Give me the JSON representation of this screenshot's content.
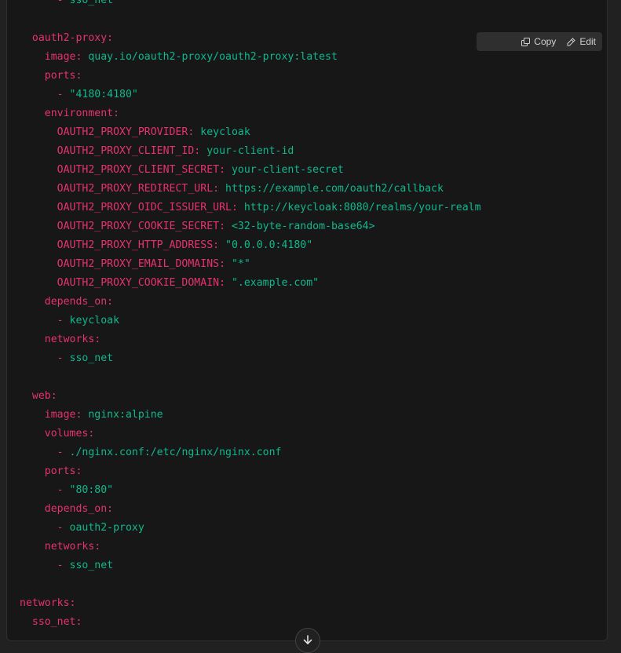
{
  "toolbar": {
    "copy_label": "Copy",
    "edit_label": "Edit",
    "copy_icon": "copy-icon",
    "edit_icon": "pencil-icon"
  },
  "scroll_button": {
    "icon": "arrow-down-icon"
  },
  "colors": {
    "key": "#e6336e",
    "value": "#0fb88d",
    "background": "#171717"
  },
  "code": {
    "language": "yaml",
    "lines": [
      {
        "indent": "      ",
        "dash": "- ",
        "key": "",
        "value": "sso_net"
      },
      {
        "indent": "",
        "dash": "",
        "key": "",
        "value": ""
      },
      {
        "indent": "  ",
        "dash": "",
        "key": "oauth2-proxy:",
        "value": ""
      },
      {
        "indent": "    ",
        "dash": "",
        "key": "image:",
        "value": " quay.io/oauth2-proxy/oauth2-proxy:latest"
      },
      {
        "indent": "    ",
        "dash": "",
        "key": "ports:",
        "value": ""
      },
      {
        "indent": "      ",
        "dash": "- ",
        "key": "",
        "value": "\"4180:4180\""
      },
      {
        "indent": "    ",
        "dash": "",
        "key": "environment:",
        "value": ""
      },
      {
        "indent": "      ",
        "dash": "",
        "key": "OAUTH2_PROXY_PROVIDER:",
        "value": " keycloak"
      },
      {
        "indent": "      ",
        "dash": "",
        "key": "OAUTH2_PROXY_CLIENT_ID:",
        "value": " your-client-id"
      },
      {
        "indent": "      ",
        "dash": "",
        "key": "OAUTH2_PROXY_CLIENT_SECRET:",
        "value": " your-client-secret"
      },
      {
        "indent": "      ",
        "dash": "",
        "key": "OAUTH2_PROXY_REDIRECT_URL:",
        "value": " https://example.com/oauth2/callback"
      },
      {
        "indent": "      ",
        "dash": "",
        "key": "OAUTH2_PROXY_OIDC_ISSUER_URL:",
        "value": " http://keycloak:8080/realms/your-realm"
      },
      {
        "indent": "      ",
        "dash": "",
        "key": "OAUTH2_PROXY_COOKIE_SECRET:",
        "value": " <32-byte-random-base64>"
      },
      {
        "indent": "      ",
        "dash": "",
        "key": "OAUTH2_PROXY_HTTP_ADDRESS:",
        "value": " \"0.0.0.0:4180\""
      },
      {
        "indent": "      ",
        "dash": "",
        "key": "OAUTH2_PROXY_EMAIL_DOMAINS:",
        "value": " \"*\""
      },
      {
        "indent": "      ",
        "dash": "",
        "key": "OAUTH2_PROXY_COOKIE_DOMAIN:",
        "value": " \".example.com\""
      },
      {
        "indent": "    ",
        "dash": "",
        "key": "depends_on:",
        "value": ""
      },
      {
        "indent": "      ",
        "dash": "- ",
        "key": "",
        "value": "keycloak"
      },
      {
        "indent": "    ",
        "dash": "",
        "key": "networks:",
        "value": ""
      },
      {
        "indent": "      ",
        "dash": "- ",
        "key": "",
        "value": "sso_net"
      },
      {
        "indent": "",
        "dash": "",
        "key": "",
        "value": ""
      },
      {
        "indent": "  ",
        "dash": "",
        "key": "web:",
        "value": ""
      },
      {
        "indent": "    ",
        "dash": "",
        "key": "image:",
        "value": " nginx:alpine"
      },
      {
        "indent": "    ",
        "dash": "",
        "key": "volumes:",
        "value": ""
      },
      {
        "indent": "      ",
        "dash": "- ",
        "key": "",
        "value": "./nginx.conf:/etc/nginx/nginx.conf"
      },
      {
        "indent": "    ",
        "dash": "",
        "key": "ports:",
        "value": ""
      },
      {
        "indent": "      ",
        "dash": "- ",
        "key": "",
        "value": "\"80:80\""
      },
      {
        "indent": "    ",
        "dash": "",
        "key": "depends_on:",
        "value": ""
      },
      {
        "indent": "      ",
        "dash": "- ",
        "key": "",
        "value": "oauth2-proxy"
      },
      {
        "indent": "    ",
        "dash": "",
        "key": "networks:",
        "value": ""
      },
      {
        "indent": "      ",
        "dash": "- ",
        "key": "",
        "value": "sso_net"
      },
      {
        "indent": "",
        "dash": "",
        "key": "",
        "value": ""
      },
      {
        "indent": "",
        "dash": "",
        "key": "networks:",
        "value": ""
      },
      {
        "indent": "  ",
        "dash": "",
        "key": "sso_net:",
        "value": ""
      }
    ]
  }
}
